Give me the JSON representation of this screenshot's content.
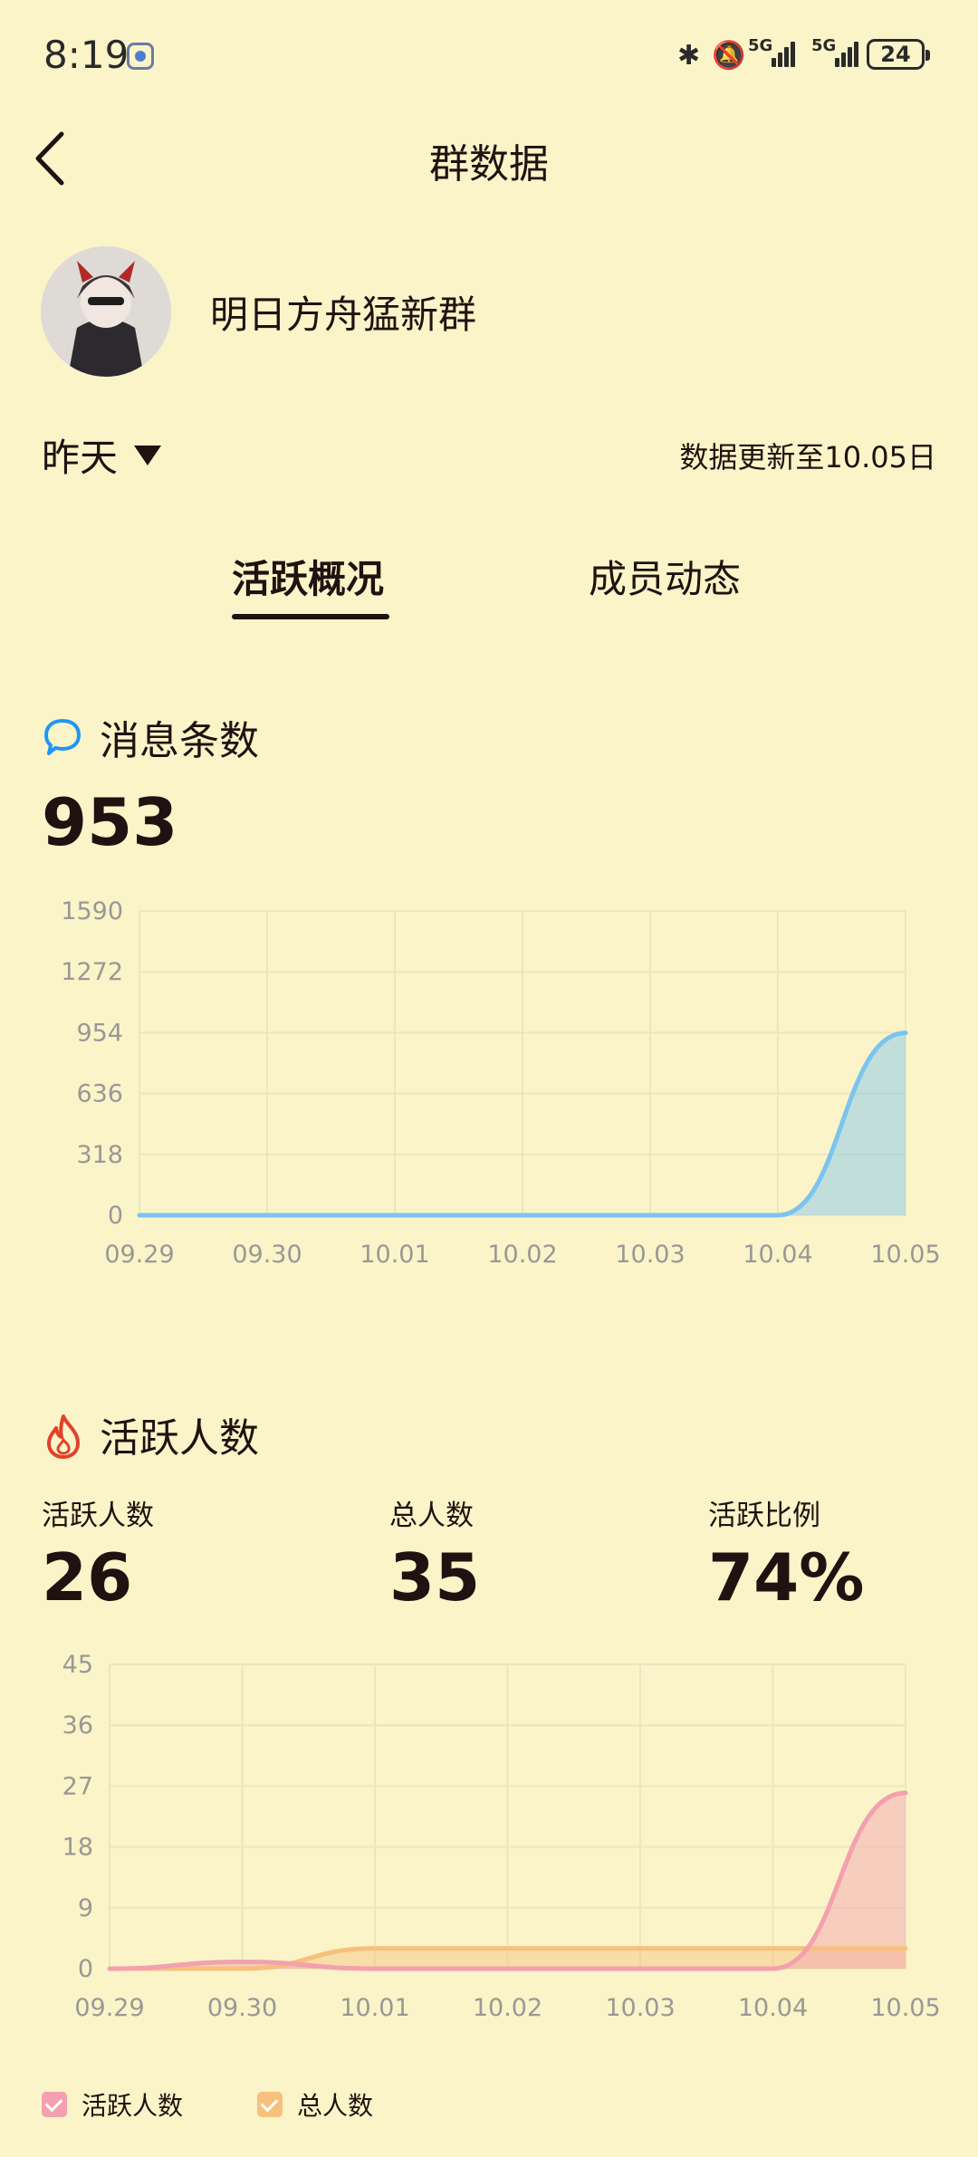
{
  "status_bar": {
    "time": "8:19",
    "signal1": "5G",
    "signal2": "5G",
    "battery": "24"
  },
  "header": {
    "title": "群数据"
  },
  "group": {
    "name": "明日方舟猛新群"
  },
  "period": {
    "selected": "昨天",
    "update_note": "数据更新至10.05日"
  },
  "tabs": [
    {
      "label": "活跃概况",
      "active": true
    },
    {
      "label": "成员动态",
      "active": false
    }
  ],
  "messages": {
    "title": "消息条数",
    "value": "953"
  },
  "active": {
    "title": "活跃人数",
    "stats": [
      {
        "label": "活跃人数",
        "value": "26"
      },
      {
        "label": "总人数",
        "value": "35"
      },
      {
        "label": "活跃比例",
        "value": "74%"
      }
    ]
  },
  "colors": {
    "background": "#faf4c8",
    "text": "#1f1210",
    "message_line": "#7cc4f0",
    "active_line": "#f3a0b0",
    "total_line": "#f6c07e"
  },
  "icons": {
    "back": "chevron-left-icon",
    "message": "chat-bubble-icon",
    "active": "flame-icon"
  },
  "chart_data": [
    {
      "type": "area",
      "categories": [
        "09.29",
        "09.30",
        "10.01",
        "10.02",
        "10.03",
        "10.04",
        "10.05"
      ],
      "y_ticks": [
        "1590",
        "1272",
        "954",
        "636",
        "318",
        "0"
      ],
      "ylim": [
        0,
        1590
      ],
      "grid": true,
      "series": [
        {
          "values": [
            0,
            0,
            0,
            0,
            0,
            0,
            953
          ],
          "color": "#7cc4f0"
        }
      ]
    },
    {
      "type": "area",
      "categories": [
        "09.29",
        "09.30",
        "10.01",
        "10.02",
        "10.03",
        "10.04",
        "10.05"
      ],
      "y_ticks": [
        "45",
        "36",
        "27",
        "18",
        "9",
        "0"
      ],
      "ylim": [
        0,
        45
      ],
      "grid": true,
      "legend": "bottom-left",
      "series": [
        {
          "name": "活跃人数",
          "values": [
            0,
            1,
            0,
            0,
            0,
            0,
            26
          ],
          "color": "#f3a0b0"
        },
        {
          "name": "总人数",
          "values": [
            0,
            0,
            3,
            3,
            3,
            3,
            3
          ],
          "color": "#f6c07e"
        }
      ]
    }
  ]
}
